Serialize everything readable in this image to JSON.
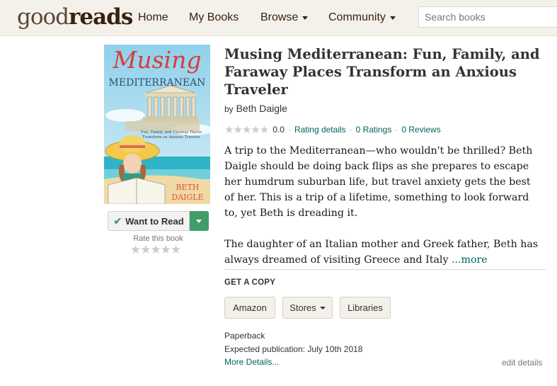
{
  "header": {
    "logo_left": "good",
    "logo_right": "reads",
    "nav": {
      "home": "Home",
      "my_books": "My Books",
      "browse": "Browse",
      "community": "Community"
    },
    "search_placeholder": "Search books"
  },
  "cover": {
    "title_script": "Musing",
    "title_caps": "MEDITERRANEAN",
    "subtitle_line1": "Fun, Family, and Faraway Places",
    "subtitle_line2": "Transform an Anxious Traveler",
    "author_first": "BETH",
    "author_last": "DAIGLE"
  },
  "shelf": {
    "want_to_read": "Want to Read",
    "rate_label": "Rate this book",
    "rate_stars": 5
  },
  "book": {
    "title": "Musing Mediterranean: Fun, Family, and Faraway Places Transform an Anxious Traveler",
    "by": "by",
    "author": "Beth Daigle",
    "avg_rating": "0.0",
    "rating_details": "Rating details",
    "ratings": "0 Ratings",
    "reviews": "0 Reviews",
    "separator": "·",
    "description_p1": "A trip to the Mediterranean—who wouldn't be thrilled? Beth Daigle should be doing back flips as she prepares to escape her humdrum suburban life, but travel anxiety gets the best of her. This is a trip of a lifetime, something to look forward to, yet Beth is dreading it.",
    "description_p2": "The daughter of an Italian mother and Greek father, Beth has always dreamed of visiting Greece and Italy ",
    "more": "...more"
  },
  "get_copy": {
    "heading": "GET A COPY",
    "amazon": "Amazon",
    "stores": "Stores",
    "libraries": "Libraries"
  },
  "edition": {
    "format": "Paperback",
    "publication": "Expected publication: July 10th 2018",
    "more_details": "More Details...",
    "edit_details": "edit details"
  },
  "colors": {
    "header_bg": "#f4f1ea",
    "brand_brown": "#382110",
    "link_teal": "#00635d",
    "button_green": "#409d69"
  }
}
